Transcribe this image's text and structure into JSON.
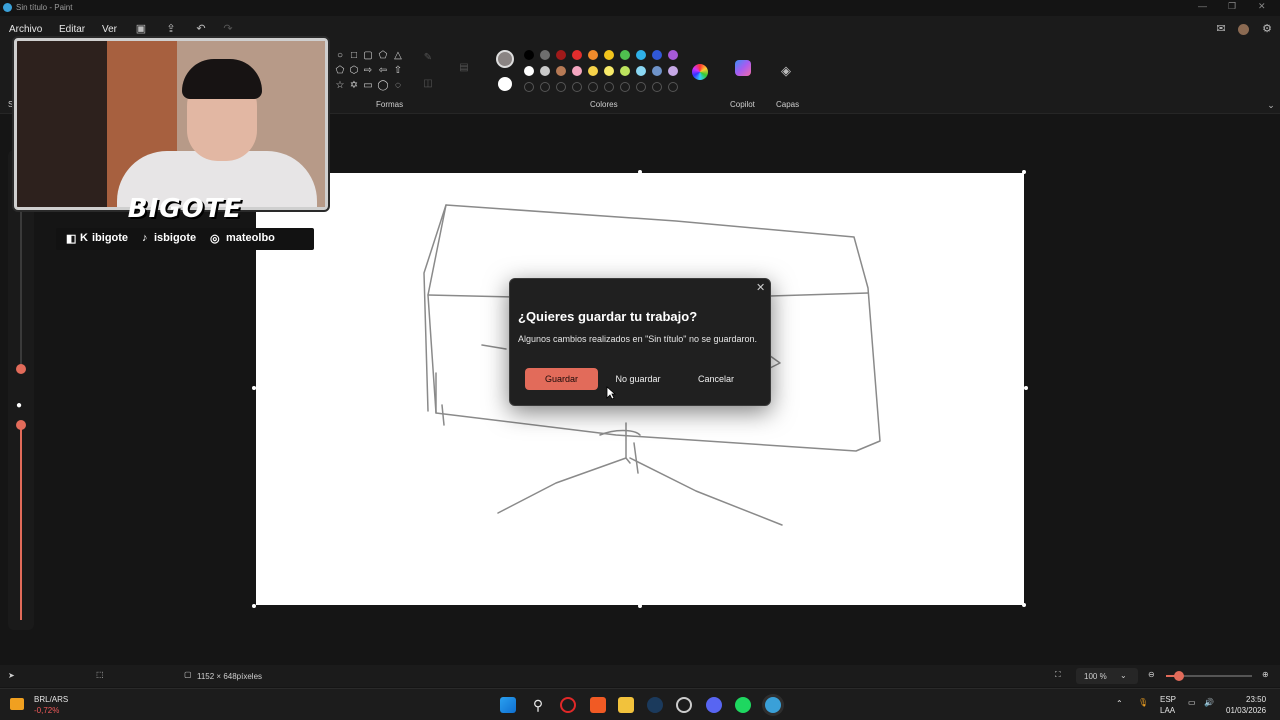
{
  "window": {
    "title": "Sin título - Paint"
  },
  "menu": {
    "file": "Archivo",
    "edit": "Editar",
    "view": "Ver"
  },
  "ribbon": {
    "selection_partial": "Sel",
    "shapes_label": "Formas",
    "colors_label": "Colores",
    "copilot_label": "Copilot",
    "layers_label": "Capas",
    "colors": {
      "current_primary": "#8a8483",
      "current_secondary": "#ffffff",
      "row1": [
        "#000000",
        "#6e6e6e",
        "#a01a1a",
        "#e12d2d",
        "#f28b2b",
        "#f2c41c",
        "#4fc04f",
        "#2fb0e8",
        "#3058d8",
        "#a659d8"
      ],
      "row2": [
        "#ffffff",
        "#c9c9c9",
        "#b77a55",
        "#f4a6c0",
        "#f6d24a",
        "#f7ea6a",
        "#bde35e",
        "#8ad7f3",
        "#6f93c9",
        "#c6a8e6"
      ]
    }
  },
  "dialog": {
    "title": "¿Quieres guardar tu trabajo?",
    "message": "Algunos cambios realizados en \"Sin título\" no se guardaron.",
    "save": "Guardar",
    "dont_save": "No guardar",
    "cancel": "Cancelar"
  },
  "overlay": {
    "logo": "BIGOTE",
    "twitch": "ibigote",
    "tiktok": "isbigote",
    "instagram": "mateolbo"
  },
  "status": {
    "canvas_size": "1152 × 648píxeles",
    "zoom": "100 %"
  },
  "taskbar": {
    "ticker_name": "BRL/ARS",
    "ticker_change": "-0,72%",
    "lang_top": "ESP",
    "lang_bottom": "LAA",
    "time": "23:50",
    "date": "01/03/2026"
  }
}
